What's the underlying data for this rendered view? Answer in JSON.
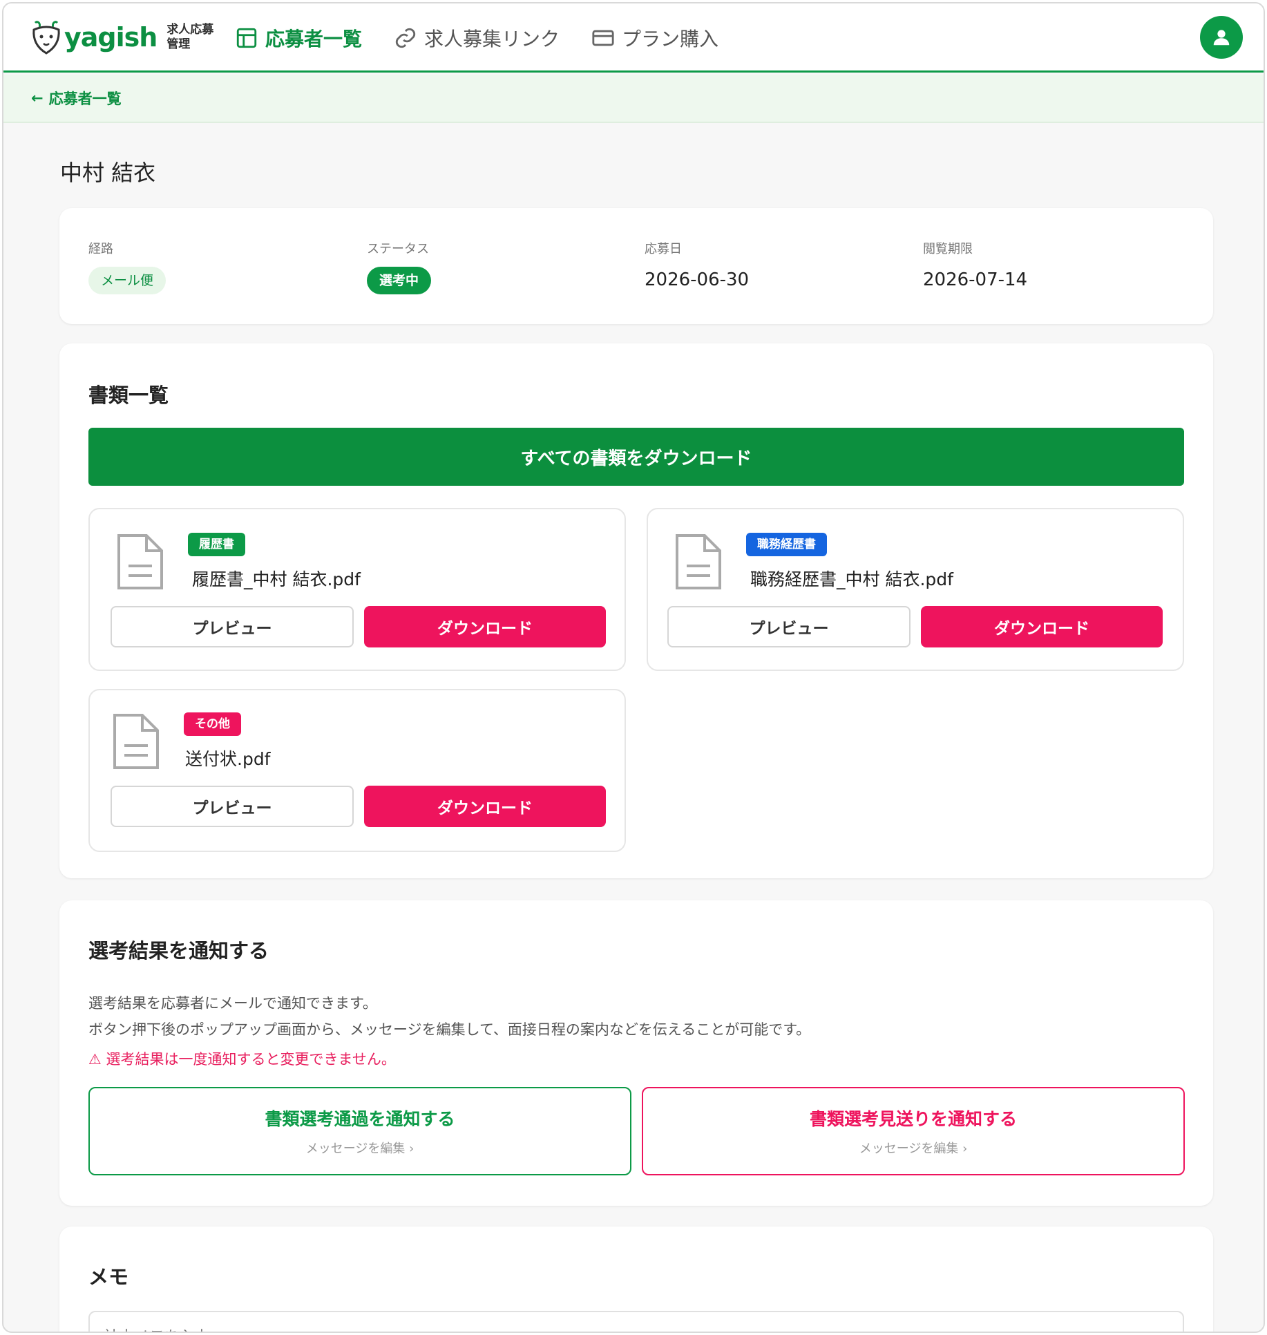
{
  "header": {
    "logo_text": "yagish",
    "logo_sub_line1": "求人応募",
    "logo_sub_line2": "管理",
    "nav": [
      {
        "label": "応募者一覧",
        "icon": "layout-icon",
        "active": true
      },
      {
        "label": "求人募集リンク",
        "icon": "link-icon",
        "active": false
      },
      {
        "label": "プラン購入",
        "icon": "credit-card-icon",
        "active": false
      }
    ],
    "avatar_icon": "user-icon"
  },
  "breadcrumb": {
    "back_label": "応募者一覧"
  },
  "applicant": {
    "name": "中村 結衣"
  },
  "info": {
    "route_label": "経路",
    "route_value": "メール便",
    "status_label": "ステータス",
    "status_value": "選考中",
    "applied_label": "応募日",
    "applied_value": "2026-06-30",
    "deadline_label": "閲覧期限",
    "deadline_value": "2026-07-14"
  },
  "documents": {
    "title": "書類一覧",
    "download_all_label": "すべての書類をダウンロード",
    "items": [
      {
        "tag": "履歴書",
        "tag_color": "#0c9a47",
        "filename": "履歴書_中村 結衣.pdf",
        "preview_label": "プレビュー",
        "download_label": "ダウンロード"
      },
      {
        "tag": "職務経歴書",
        "tag_color": "#1565e0",
        "filename": "職務経歴書_中村 結衣.pdf",
        "preview_label": "プレビュー",
        "download_label": "ダウンロード"
      },
      {
        "tag": "その他",
        "tag_color": "#ee145d",
        "filename": "送付状.pdf",
        "preview_label": "プレビュー",
        "download_label": "ダウンロード"
      }
    ]
  },
  "notify": {
    "title": "選考結果を通知する",
    "desc_line1": "選考結果を応募者にメールで通知できます。",
    "desc_line2": "ボタン押下後のポップアップ画面から、メッセージを編集して、面接日程の案内などを伝えることが可能です。",
    "warning": "⚠ 選考結果は一度通知すると変更できません。",
    "pass_label": "書類選考通過を通知する",
    "pass_sub": "メッセージを編集 ›",
    "reject_label": "書類選考見送りを通知する",
    "reject_sub": "メッセージを編集 ›"
  },
  "memo": {
    "title": "メモ",
    "placeholder": "社内メモを入力"
  },
  "colors": {
    "brand_green": "#0c9a47",
    "accent_pink": "#ee145d",
    "tag_blue": "#1565e0"
  }
}
